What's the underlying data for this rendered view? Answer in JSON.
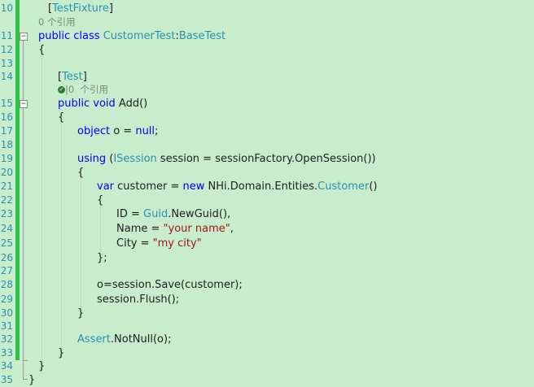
{
  "line_numbers": [
    "10",
    "11",
    "12",
    "13",
    "14",
    "15",
    "16",
    "17",
    "18",
    "19",
    "20",
    "21",
    "22",
    "23",
    "24",
    "25",
    "26",
    "27",
    "28",
    "29",
    "30",
    "31",
    "32",
    "33",
    "34",
    "35"
  ],
  "code": {
    "l10": {
      "b1": "[",
      "attr": "TestFixture",
      "b2": "]"
    },
    "lens1": "0 个引用",
    "l11": {
      "kw1": "public",
      "kw2": "class",
      "cls": "CustomerTest",
      "sep": ":",
      "base": "BaseTest"
    },
    "l12": "{",
    "l14": {
      "b1": "[",
      "attr": "Test",
      "b2": "]"
    },
    "lens2": {
      "sep": "|",
      "text": "0  个引用"
    },
    "l15": {
      "kw1": "public",
      "kw2": "void",
      "name": "Add()"
    },
    "l16": "{",
    "l17": {
      "type": "object",
      "rest": "o = ",
      "kw": "null",
      ";": ";"
    },
    "l19": {
      "kw": "using",
      "p1": "(",
      "type": "ISession",
      "rest": " session = sessionFactory.OpenSession())"
    },
    "l20": "{",
    "l21": {
      "kw1": "var",
      "rest1": "customer = ",
      "kw2": "new",
      "ns": "NHi.Domain.Entities.",
      "cls": "Customer",
      "paren": "()"
    },
    "l22": "{",
    "l23": {
      "lhs": "ID = ",
      "cls": "Guid",
      "rest": ".NewGuid(),"
    },
    "l24": {
      "lhs": "Name = ",
      "str": "\"your name\"",
      "end": ","
    },
    "l25": {
      "lhs": "City = ",
      "str": "\"my city\""
    },
    "l26": "};",
    "l28": "o=session.Save(customer);",
    "l29": "session.Flush();",
    "l30": "}",
    "l32": {
      "cls": "Assert",
      "rest": ".NotNull(o);"
    },
    "l33": "}",
    "l34": "}",
    "l35": "}"
  },
  "colors": {
    "background": "#c7edcc",
    "keyword": "#0000ff",
    "type": "#2b91af",
    "string": "#a31515",
    "change_bar": "#2fbf4a"
  },
  "icons": [
    "check-icon",
    "fold-collapse-icon"
  ]
}
